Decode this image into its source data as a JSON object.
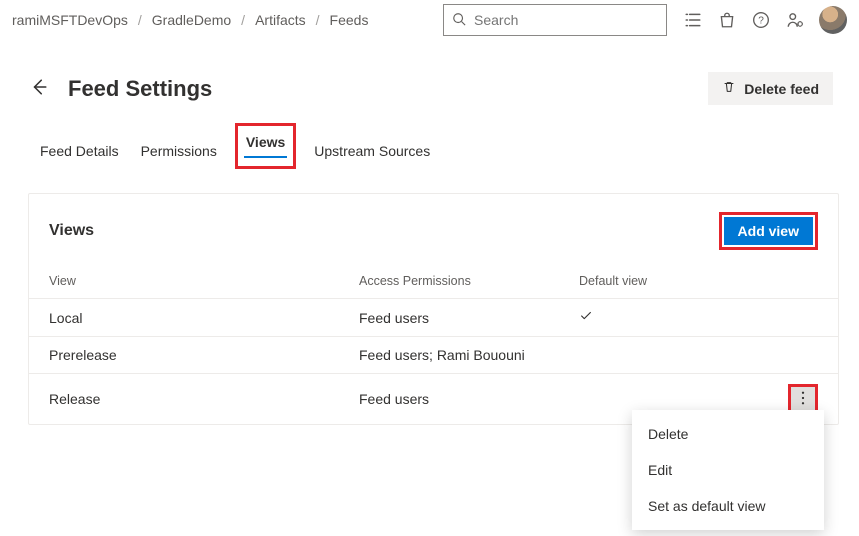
{
  "breadcrumb": [
    "ramiMSFTDevOps",
    "GradleDemo",
    "Artifacts",
    "Feeds"
  ],
  "search": {
    "placeholder": "Search"
  },
  "page": {
    "title": "Feed Settings",
    "delete_label": "Delete feed"
  },
  "tabs": [
    {
      "label": "Feed Details",
      "active": false
    },
    {
      "label": "Permissions",
      "active": false
    },
    {
      "label": "Views",
      "active": true,
      "highlight": true
    },
    {
      "label": "Upstream Sources",
      "active": false
    }
  ],
  "views_card": {
    "title": "Views",
    "add_label": "Add view",
    "columns": {
      "view": "View",
      "access": "Access Permissions",
      "default": "Default view"
    },
    "rows": [
      {
        "view": "Local",
        "access": "Feed users",
        "default": true
      },
      {
        "view": "Prerelease",
        "access": "Feed users; Rami Bououni",
        "default": false
      },
      {
        "view": "Release",
        "access": "Feed users",
        "default": false,
        "menu_open": true
      }
    ]
  },
  "context_menu": {
    "items": [
      "Delete",
      "Edit",
      "Set as default view"
    ]
  }
}
